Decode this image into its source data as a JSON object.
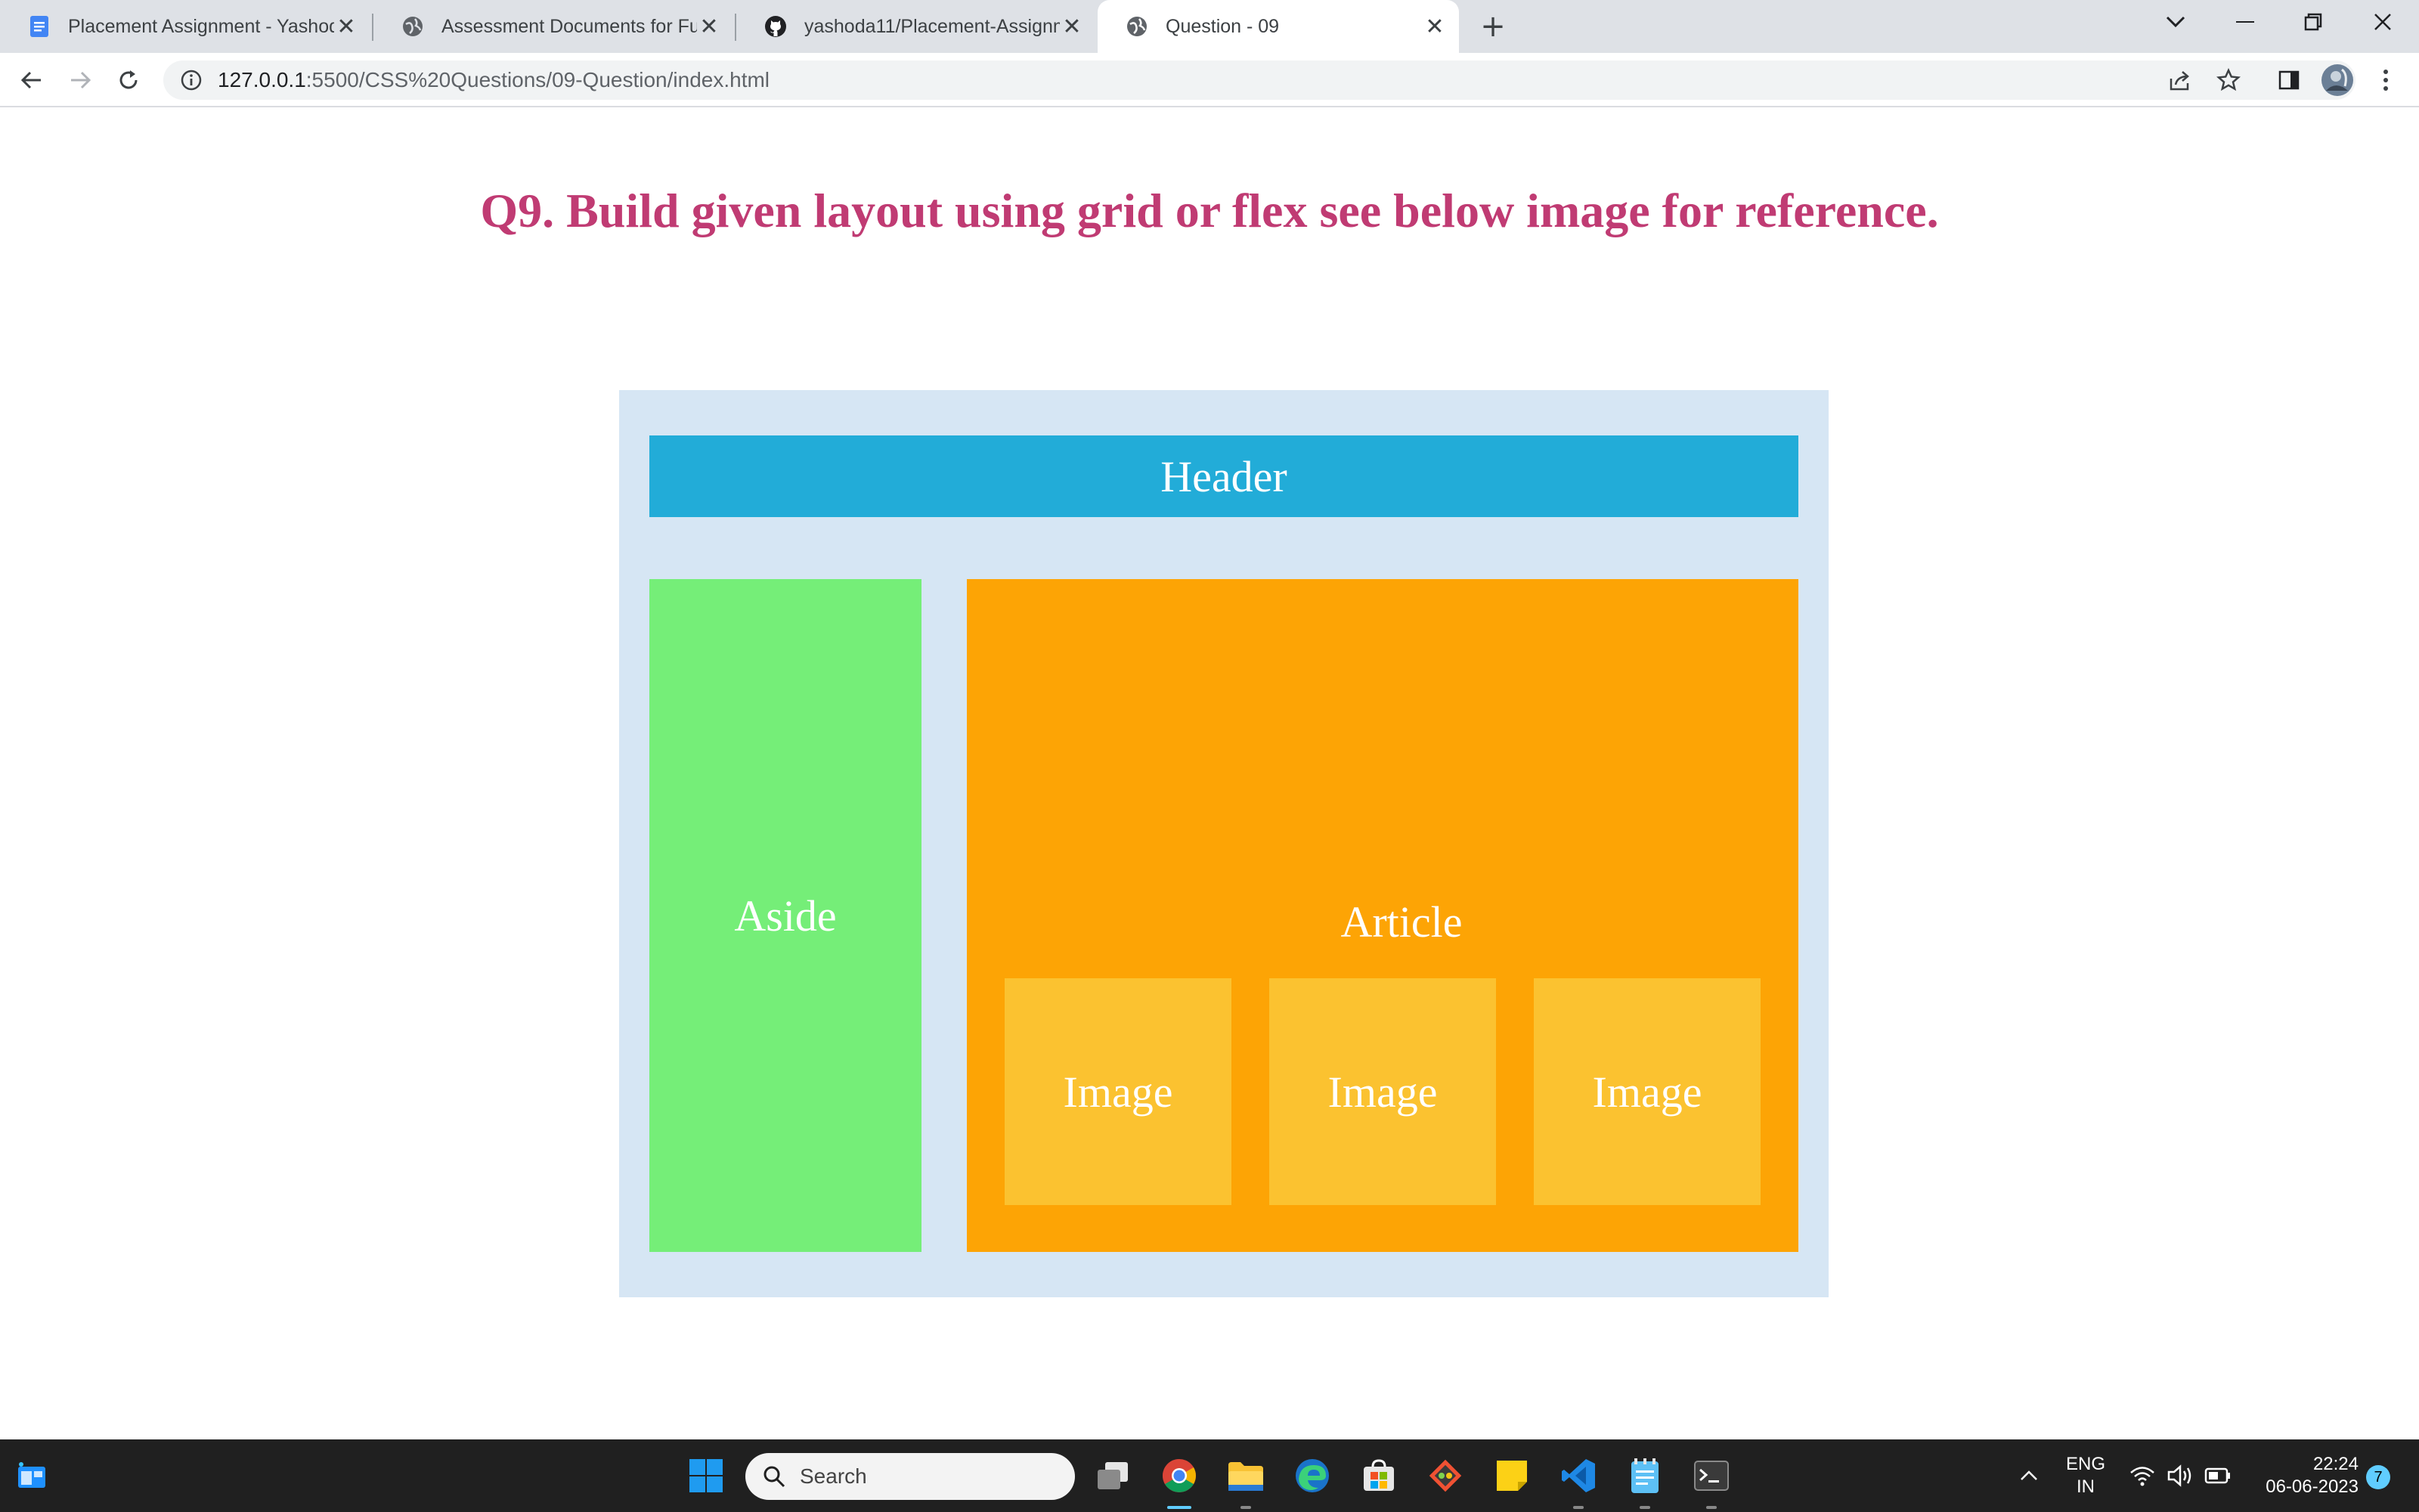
{
  "browser": {
    "tabs": [
      {
        "title": "Placement Assignment - Yashoda",
        "icon": "google-docs-icon",
        "active": false
      },
      {
        "title": "Assessment Documents for Full S",
        "icon": "globe-icon",
        "active": false
      },
      {
        "title": "yashoda11/Placement-Assignme",
        "icon": "github-icon",
        "active": false
      },
      {
        "title": "Question - 09",
        "icon": "globe-icon",
        "active": true
      }
    ],
    "close_glyph": "✕",
    "new_tab_glyph": "+",
    "url_host": "127.0.0.1",
    "url_path": ":5500/CSS%20Questions/09-Question/index.html"
  },
  "page": {
    "title": "Q9. Build given layout using grid or flex see below image for reference.",
    "header_label": "Header",
    "aside_label": "Aside",
    "article_label": "Article",
    "images": [
      "Image",
      "Image",
      "Image"
    ],
    "colors": {
      "title": "#c03b73",
      "container": "#d6e6f4",
      "header": "#22acd8",
      "aside": "#75ee78",
      "article": "#fda405",
      "image": "#fbc230"
    }
  },
  "taskbar": {
    "search_placeholder": "Search",
    "language_top": "ENG",
    "language_bottom": "IN",
    "time": "22:24",
    "date": "06-06-2023",
    "notification_count": "7"
  }
}
